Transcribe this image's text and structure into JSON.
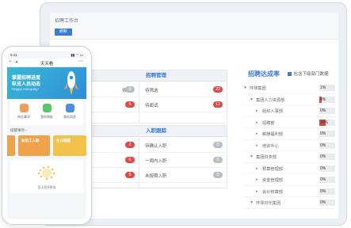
{
  "desktop": {
    "window_title": "招聘工作台",
    "button_label": "刷新",
    "recruit_panel": {
      "title": "招聘管理",
      "rows": [
        {
          "label": "待筛选",
          "count": "22",
          "status": "red"
        },
        {
          "label": "待面试",
          "count": "11",
          "status": "red"
        }
      ],
      "left_stub_counts": [
        "0",
        "5"
      ],
      "left_stub_label": "待"
    },
    "onboard_panel": {
      "title": "入职跟踪",
      "rows": [
        {
          "label": "待确认入职",
          "count": "0",
          "status": "gray"
        },
        {
          "label": "一周内入职",
          "count": "0",
          "status": "gray"
        },
        {
          "label": "未按期入职",
          "count": "0",
          "status": "gray"
        }
      ],
      "left_stub_counts": [
        "2",
        "6",
        "5"
      ]
    },
    "tree_panel": {
      "title": "招聘达成率",
      "checkbox_label": "包含下级部门数据",
      "checked": true,
      "nodes": [
        {
          "label": "环球集团",
          "level": 0,
          "percent": "1%",
          "fill": 0.0
        },
        {
          "label": "集团人力资源部",
          "level": 1,
          "percent": "4%",
          "fill": 0.15
        },
        {
          "label": "组织人事部",
          "level": 2,
          "percent": "0%",
          "fill": 0.0
        },
        {
          "label": "招聘部",
          "level": 2,
          "percent": "38%",
          "fill": 0.4
        },
        {
          "label": "薪酬福利部",
          "level": 2,
          "percent": "0%",
          "fill": 0.0
        },
        {
          "label": "培训中心",
          "level": 2,
          "percent": "0%",
          "fill": 0.0
        },
        {
          "label": "集团财务部",
          "level": 1,
          "percent": "0%",
          "fill": 0.0
        },
        {
          "label": "预算管理部",
          "level": 2,
          "percent": "0%",
          "fill": 0.0
        },
        {
          "label": "资金管理部",
          "level": 2,
          "percent": "0%",
          "fill": 0.0
        },
        {
          "label": "会计核算部",
          "level": 2,
          "percent": "0%",
          "fill": 0.0
        },
        {
          "label": "环球日化集团",
          "level": 1,
          "percent": "0%",
          "fill": 0.0
        }
      ]
    }
  },
  "phone": {
    "time": "9:41",
    "app_title": "天天看",
    "hero_line1": "掌握招聘进度",
    "hero_line2": "纵览人员动态",
    "hero_line3": "Happy everyday!",
    "tiles": [
      {
        "label": "待办事项",
        "color": "#f29b5a"
      },
      {
        "label": "我的审批",
        "color": "#5cc46a"
      },
      {
        "label": "我的消息",
        "color": "#4a8fe0"
      }
    ],
    "reminder_label": "提醒事项",
    "cards": [
      {
        "label": "新员工入职",
        "color": "#f0a24b"
      },
      {
        "label": "生日提醒",
        "color": "#f3c24b"
      }
    ],
    "bottom_caption": "暂无更多数据"
  }
}
